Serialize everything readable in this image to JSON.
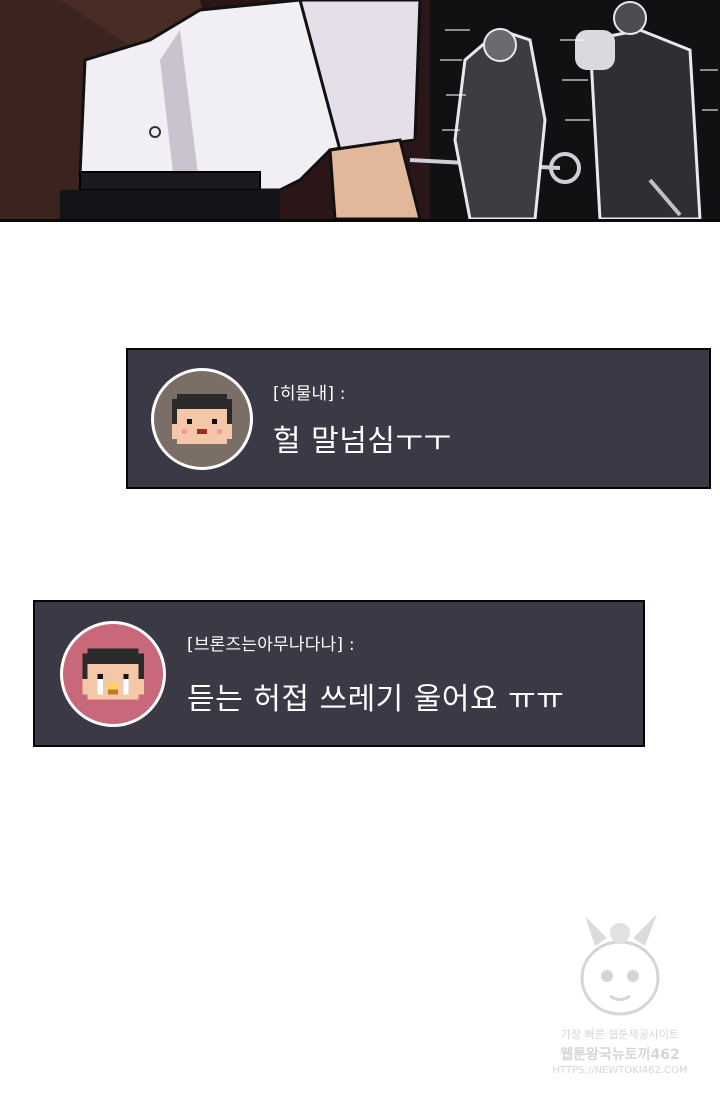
{
  "chat": [
    {
      "username": "[히물내] :",
      "message": "헐 말넘심ㅜㅜ",
      "avatar_bg": "#7a6e66",
      "avatar_icon": "pixel-face-icon"
    },
    {
      "username": "[브론즈는아무나다나] :",
      "message": "듣는 허접 쓰레기 울어요 ㅠㅠ",
      "avatar_bg": "#c8687a",
      "avatar_icon": "pixel-crying-face-icon"
    }
  ],
  "watermark": {
    "line1": "가장 빠른 웹툰제공사이트",
    "line2": "웹툰왕국뉴토끼462",
    "line3": "HTTPS://NEWTOKI462.COM"
  },
  "colors": {
    "chat_bg": "#3a3945",
    "chat_border": "#050505",
    "text": "#ffffff"
  }
}
